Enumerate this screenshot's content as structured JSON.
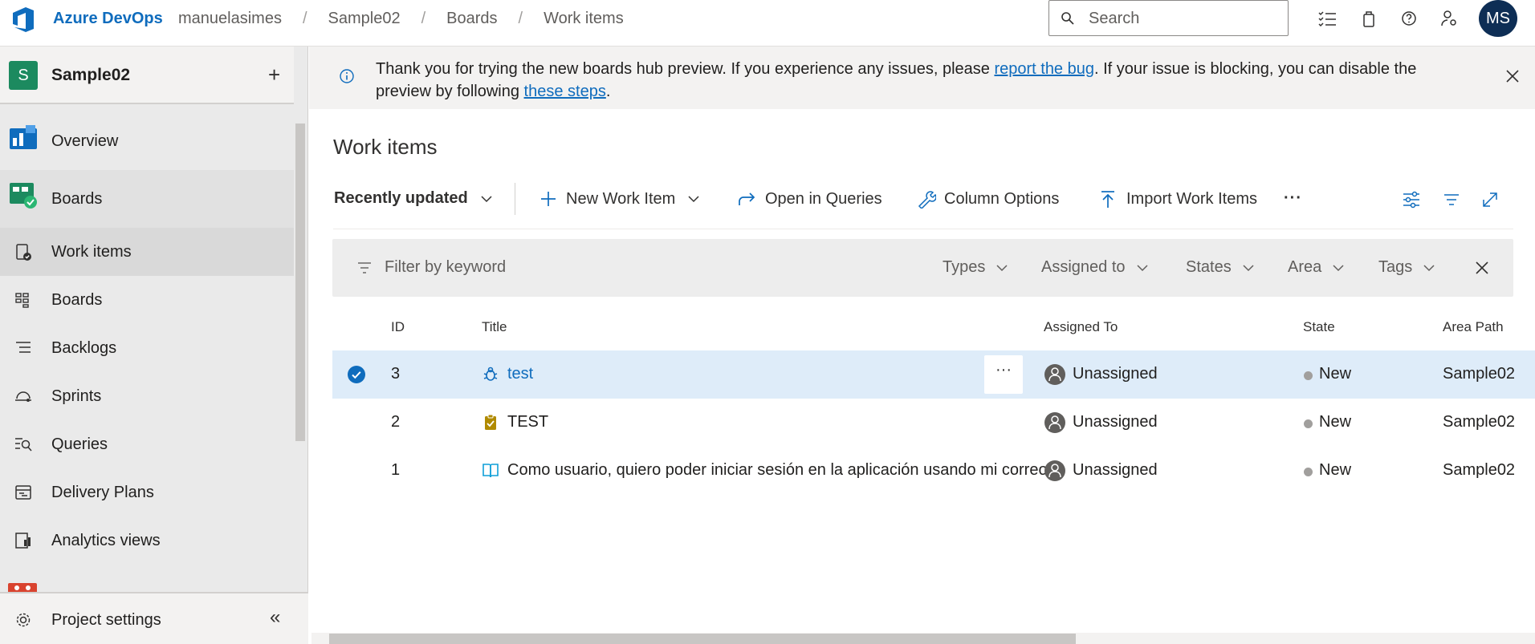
{
  "header": {
    "brand": "Azure DevOps",
    "breadcrumbs": [
      "manuelasimes",
      "Sample02",
      "Boards",
      "Work items"
    ],
    "search_placeholder": "Search",
    "avatar_initials": "MS"
  },
  "sidebar": {
    "project_badge": "S",
    "project_name": "Sample02",
    "add": "+",
    "items": [
      {
        "label": "Overview",
        "icon": "overview-icon"
      },
      {
        "label": "Boards",
        "icon": "boards-hub-icon"
      },
      {
        "label": "Work items",
        "icon": "work-items-icon",
        "selected": true
      },
      {
        "label": "Boards",
        "icon": "boards-icon"
      },
      {
        "label": "Backlogs",
        "icon": "backlogs-icon"
      },
      {
        "label": "Sprints",
        "icon": "sprints-icon"
      },
      {
        "label": "Queries",
        "icon": "queries-icon"
      },
      {
        "label": "Delivery Plans",
        "icon": "delivery-plans-icon"
      },
      {
        "label": "Analytics views",
        "icon": "analytics-views-icon"
      }
    ],
    "settings_label": "Project settings",
    "collapse": "«"
  },
  "banner": {
    "text_before": "Thank you for trying the new boards hub preview. If you experience any issues, please ",
    "link1": "report the bug",
    "text_mid": ". If your issue is blocking, you can disable the preview by following ",
    "link2": "these steps",
    "text_after": "."
  },
  "page": {
    "title": "Work items"
  },
  "toolbar": {
    "view_selector": "Recently updated",
    "new_work_item": "New Work Item",
    "open_in_queries": "Open in Queries",
    "column_options": "Column Options",
    "import_work_items": "Import Work Items",
    "more": "···"
  },
  "filter": {
    "placeholder": "Filter by keyword",
    "dropdowns": [
      "Types",
      "Assigned to",
      "States",
      "Area",
      "Tags"
    ]
  },
  "table": {
    "columns": [
      "ID",
      "Title",
      "Assigned To",
      "State",
      "Area Path"
    ],
    "rows": [
      {
        "id": "3",
        "title": "test",
        "type": "bug",
        "assigned": "Unassigned",
        "state": "New",
        "area": "Sample02",
        "selected": true
      },
      {
        "id": "2",
        "title": "TEST",
        "type": "task",
        "assigned": "Unassigned",
        "state": "New",
        "area": "Sample02"
      },
      {
        "id": "1",
        "title": "Como usuario, quiero poder iniciar sesión en la aplicación usando mi correo",
        "type": "user-story",
        "assigned": "Unassigned",
        "state": "New",
        "area": "Sample02"
      }
    ],
    "row_more": "···"
  },
  "colors": {
    "accent": "#0f6cbd",
    "selected_row": "#deecf9",
    "project_badge": "#1c8a5f",
    "avatar": "#0e2e55"
  }
}
